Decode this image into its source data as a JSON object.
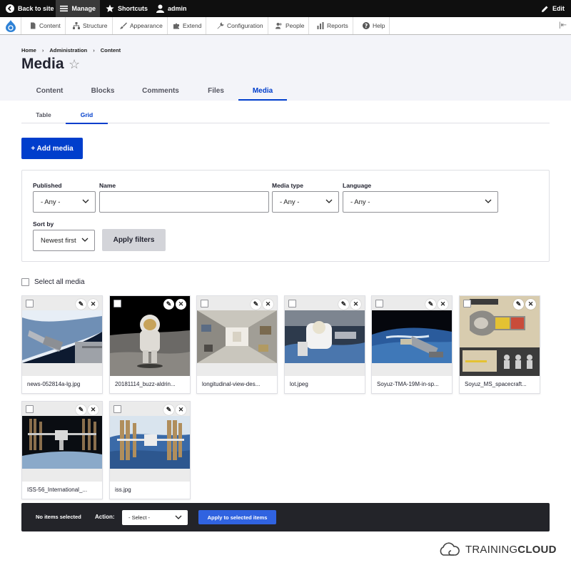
{
  "toolbar": {
    "back": "Back to site",
    "manage": "Manage",
    "shortcuts": "Shortcuts",
    "user": "admin",
    "edit": "Edit"
  },
  "menu": {
    "items": [
      "Content",
      "Structure",
      "Appearance",
      "Extend",
      "Configuration",
      "People",
      "Reports",
      "Help"
    ]
  },
  "breadcrumb": [
    "Home",
    "Administration",
    "Content"
  ],
  "page": {
    "title": "Media",
    "primary_tabs": [
      "Content",
      "Blocks",
      "Comments",
      "Files",
      "Media"
    ],
    "active_primary": "Media",
    "secondary_tabs": [
      "Table",
      "Grid"
    ],
    "active_secondary": "Grid",
    "add_button": "+ Add media"
  },
  "filters": {
    "published_label": "Published",
    "published_value": "- Any -",
    "name_label": "Name",
    "name_value": "",
    "media_type_label": "Media type",
    "media_type_value": "- Any -",
    "language_label": "Language",
    "language_value": "- Any -",
    "sort_label": "Sort by",
    "sort_value": "Newest first",
    "apply": "Apply filters"
  },
  "select_all": "Select all media",
  "media": [
    {
      "name": "news-052814a-lg.jpg"
    },
    {
      "name": "20181114_buzz-aldrin..."
    },
    {
      "name": "longitudinal-view-des..."
    },
    {
      "name": "lot.jpeg"
    },
    {
      "name": "Soyuz-TMA-19M-in-sp..."
    },
    {
      "name": "Soyuz_MS_spacecraft..."
    },
    {
      "name": "ISS-56_International_..."
    },
    {
      "name": "iss.jpg"
    }
  ],
  "bulk": {
    "status": "No items selected",
    "action_label": "Action:",
    "action_value": "- Select -",
    "apply": "Apply to selected items"
  },
  "brand": {
    "light": "TRAINING",
    "bold": "CLOUD"
  }
}
